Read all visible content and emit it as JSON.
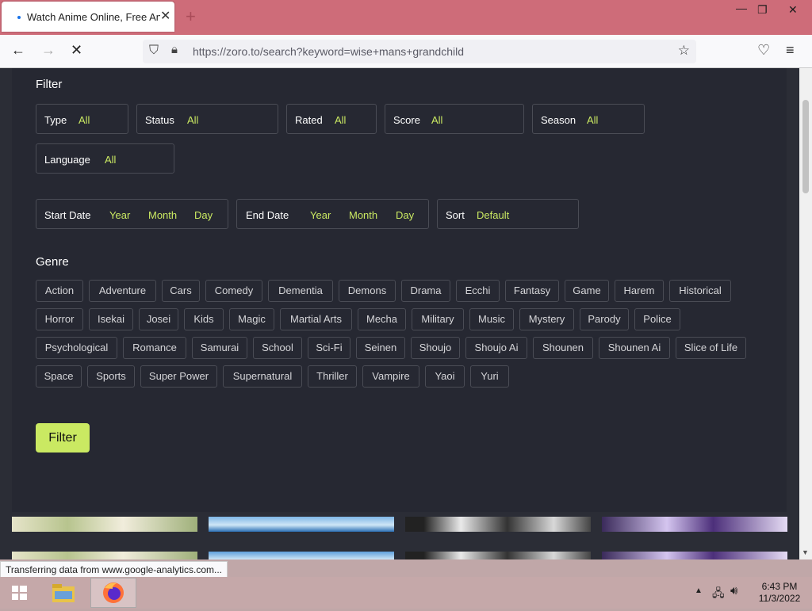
{
  "browser": {
    "tab_title": "Watch Anime Online, Free Anim",
    "tab_close": "✕",
    "new_tab": "+",
    "url": "https://zoro.to/search?keyword=wise+mans+grandchild",
    "status_text": "Transferring data from www.google-analytics.com..."
  },
  "filter": {
    "title": "Filter",
    "fields": [
      {
        "label": "Type",
        "value": "All"
      },
      {
        "label": "Status",
        "value": "All"
      },
      {
        "label": "Rated",
        "value": "All"
      },
      {
        "label": "Score",
        "value": "All"
      },
      {
        "label": "Season",
        "value": "All"
      },
      {
        "label": "Language",
        "value": "All"
      }
    ],
    "start_date": {
      "label": "Start Date",
      "year": "Year",
      "month": "Month",
      "day": "Day"
    },
    "end_date": {
      "label": "End Date",
      "year": "Year",
      "month": "Month",
      "day": "Day"
    },
    "sort": {
      "label": "Sort",
      "value": "Default"
    },
    "button": "Filter"
  },
  "genre": {
    "title": "Genre",
    "items": [
      "Action",
      "Adventure",
      "Cars",
      "Comedy",
      "Dementia",
      "Demons",
      "Drama",
      "Ecchi",
      "Fantasy",
      "Game",
      "Harem",
      "Historical",
      "Horror",
      "Isekai",
      "Josei",
      "Kids",
      "Magic",
      "Martial Arts",
      "Mecha",
      "Military",
      "Music",
      "Mystery",
      "Parody",
      "Police",
      "Psychological",
      "Romance",
      "Samurai",
      "School",
      "Sci-Fi",
      "Seinen",
      "Shoujo",
      "Shoujo Ai",
      "Shounen",
      "Shounen Ai",
      "Slice of Life",
      "Space",
      "Sports",
      "Super Power",
      "Supernatural",
      "Thriller",
      "Vampire",
      "Yaoi",
      "Yuri"
    ]
  },
  "taskbar": {
    "time": "6:43 PM",
    "date": "11/3/2022"
  },
  "colors": {
    "accent": "#cae962",
    "panel_bg": "#262832",
    "page_bg": "#2b2d36",
    "tabbar_bg": "#ce6c79"
  },
  "icons": [
    "back-arrow-icon",
    "forward-arrow-icon",
    "stop-loading-icon",
    "shield-icon",
    "lock-icon",
    "bookmark-star-icon",
    "pocket-icon",
    "menu-icon",
    "windows-start-icon",
    "file-explorer-icon",
    "firefox-icon",
    "network-icon",
    "volume-icon"
  ]
}
